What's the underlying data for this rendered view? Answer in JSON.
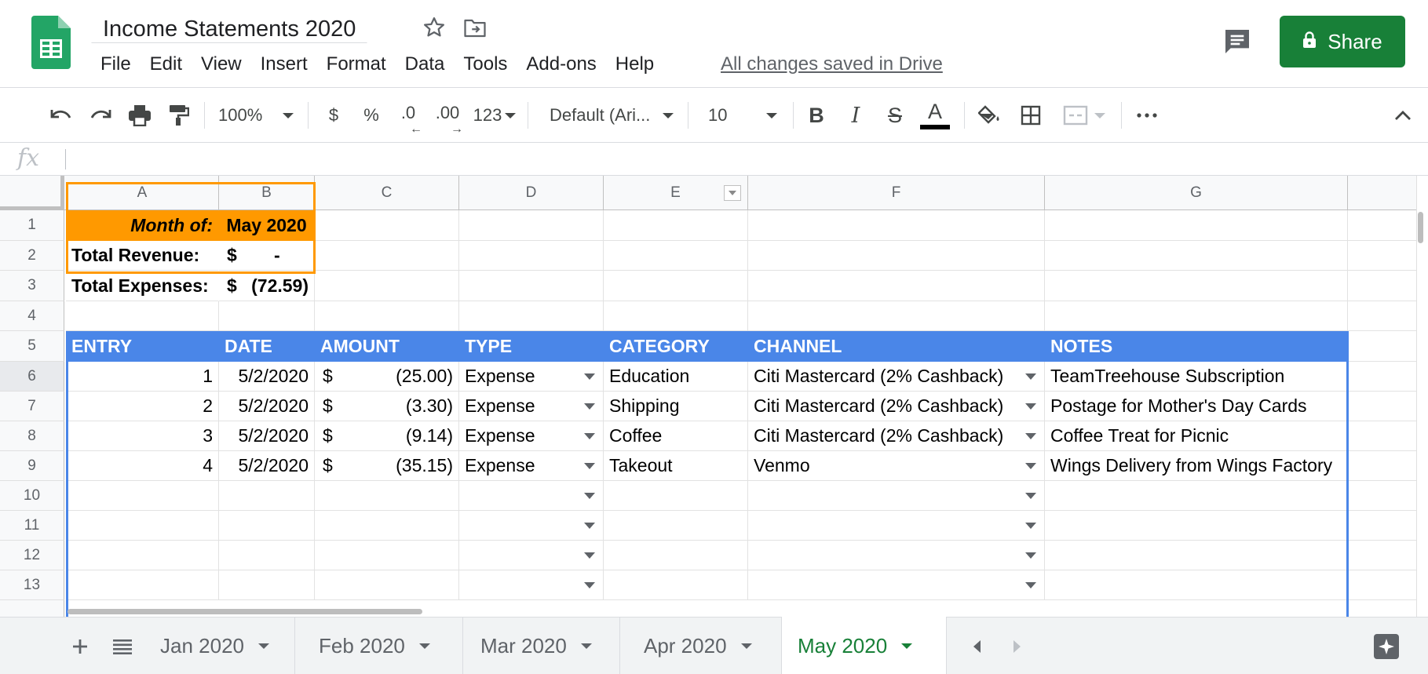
{
  "title": "Income Statements 2020",
  "menu": [
    "File",
    "Edit",
    "View",
    "Insert",
    "Format",
    "Data",
    "Tools",
    "Add-ons",
    "Help"
  ],
  "save_status": "All changes saved in Drive",
  "share_label": "Share",
  "toolbar": {
    "zoom": "100%",
    "currency": "$",
    "percent": "%",
    "dec_decrease": ".0",
    "dec_increase": ".00",
    "more_formats": "123",
    "font": "Default (Ari...",
    "font_size": "10",
    "bold": "B",
    "italic": "I",
    "strikethrough": "S",
    "text_color": "A",
    "text_color_value": "#000000"
  },
  "formula_bar": {
    "fx": "fx",
    "value": ""
  },
  "columns": [
    "A",
    "B",
    "C",
    "D",
    "E",
    "F",
    "G"
  ],
  "rows": [
    "1",
    "2",
    "3",
    "4",
    "5",
    "6",
    "7",
    "8",
    "9",
    "10",
    "11",
    "12",
    "13"
  ],
  "summary": {
    "month_label": "Month of:",
    "month_value": "May 2020",
    "revenue_label": "Total Revenue:",
    "revenue_symbol": "$",
    "revenue_value": "-",
    "expenses_label": "Total Expenses:",
    "expenses_symbol": "$",
    "expenses_value": "(72.59)"
  },
  "table": {
    "headers": [
      "ENTRY",
      "DATE",
      "AMOUNT",
      "TYPE",
      "CATEGORY",
      "CHANNEL",
      "NOTES"
    ],
    "rows": [
      {
        "entry": "1",
        "date": "5/2/2020",
        "symbol": "$",
        "amount": "(25.00)",
        "type": "Expense",
        "category": "Education",
        "channel": "Citi Mastercard (2% Cashback)",
        "notes": "TeamTreehouse Subscription"
      },
      {
        "entry": "2",
        "date": "5/2/2020",
        "symbol": "$",
        "amount": "(3.30)",
        "type": "Expense",
        "category": "Shipping",
        "channel": "Citi Mastercard (2% Cashback)",
        "notes": "Postage for Mother's Day Cards"
      },
      {
        "entry": "3",
        "date": "5/2/2020",
        "symbol": "$",
        "amount": "(9.14)",
        "type": "Expense",
        "category": "Coffee",
        "channel": "Citi Mastercard (2% Cashback)",
        "notes": "Coffee Treat for Picnic"
      },
      {
        "entry": "4",
        "date": "5/2/2020",
        "symbol": "$",
        "amount": "(35.15)",
        "type": "Expense",
        "category": "Takeout",
        "channel": "Venmo",
        "notes": "Wings Delivery from Wings Factory"
      }
    ]
  },
  "sheets": [
    "Jan 2020",
    "Feb 2020",
    "Mar 2020",
    "Apr 2020",
    "May 2020"
  ],
  "active_sheet": "May 2020",
  "colors": {
    "orange_header": "#ff9900",
    "blue_header": "#4a86e8",
    "share_green": "#188038",
    "sheets_green": "#0f9d58"
  }
}
